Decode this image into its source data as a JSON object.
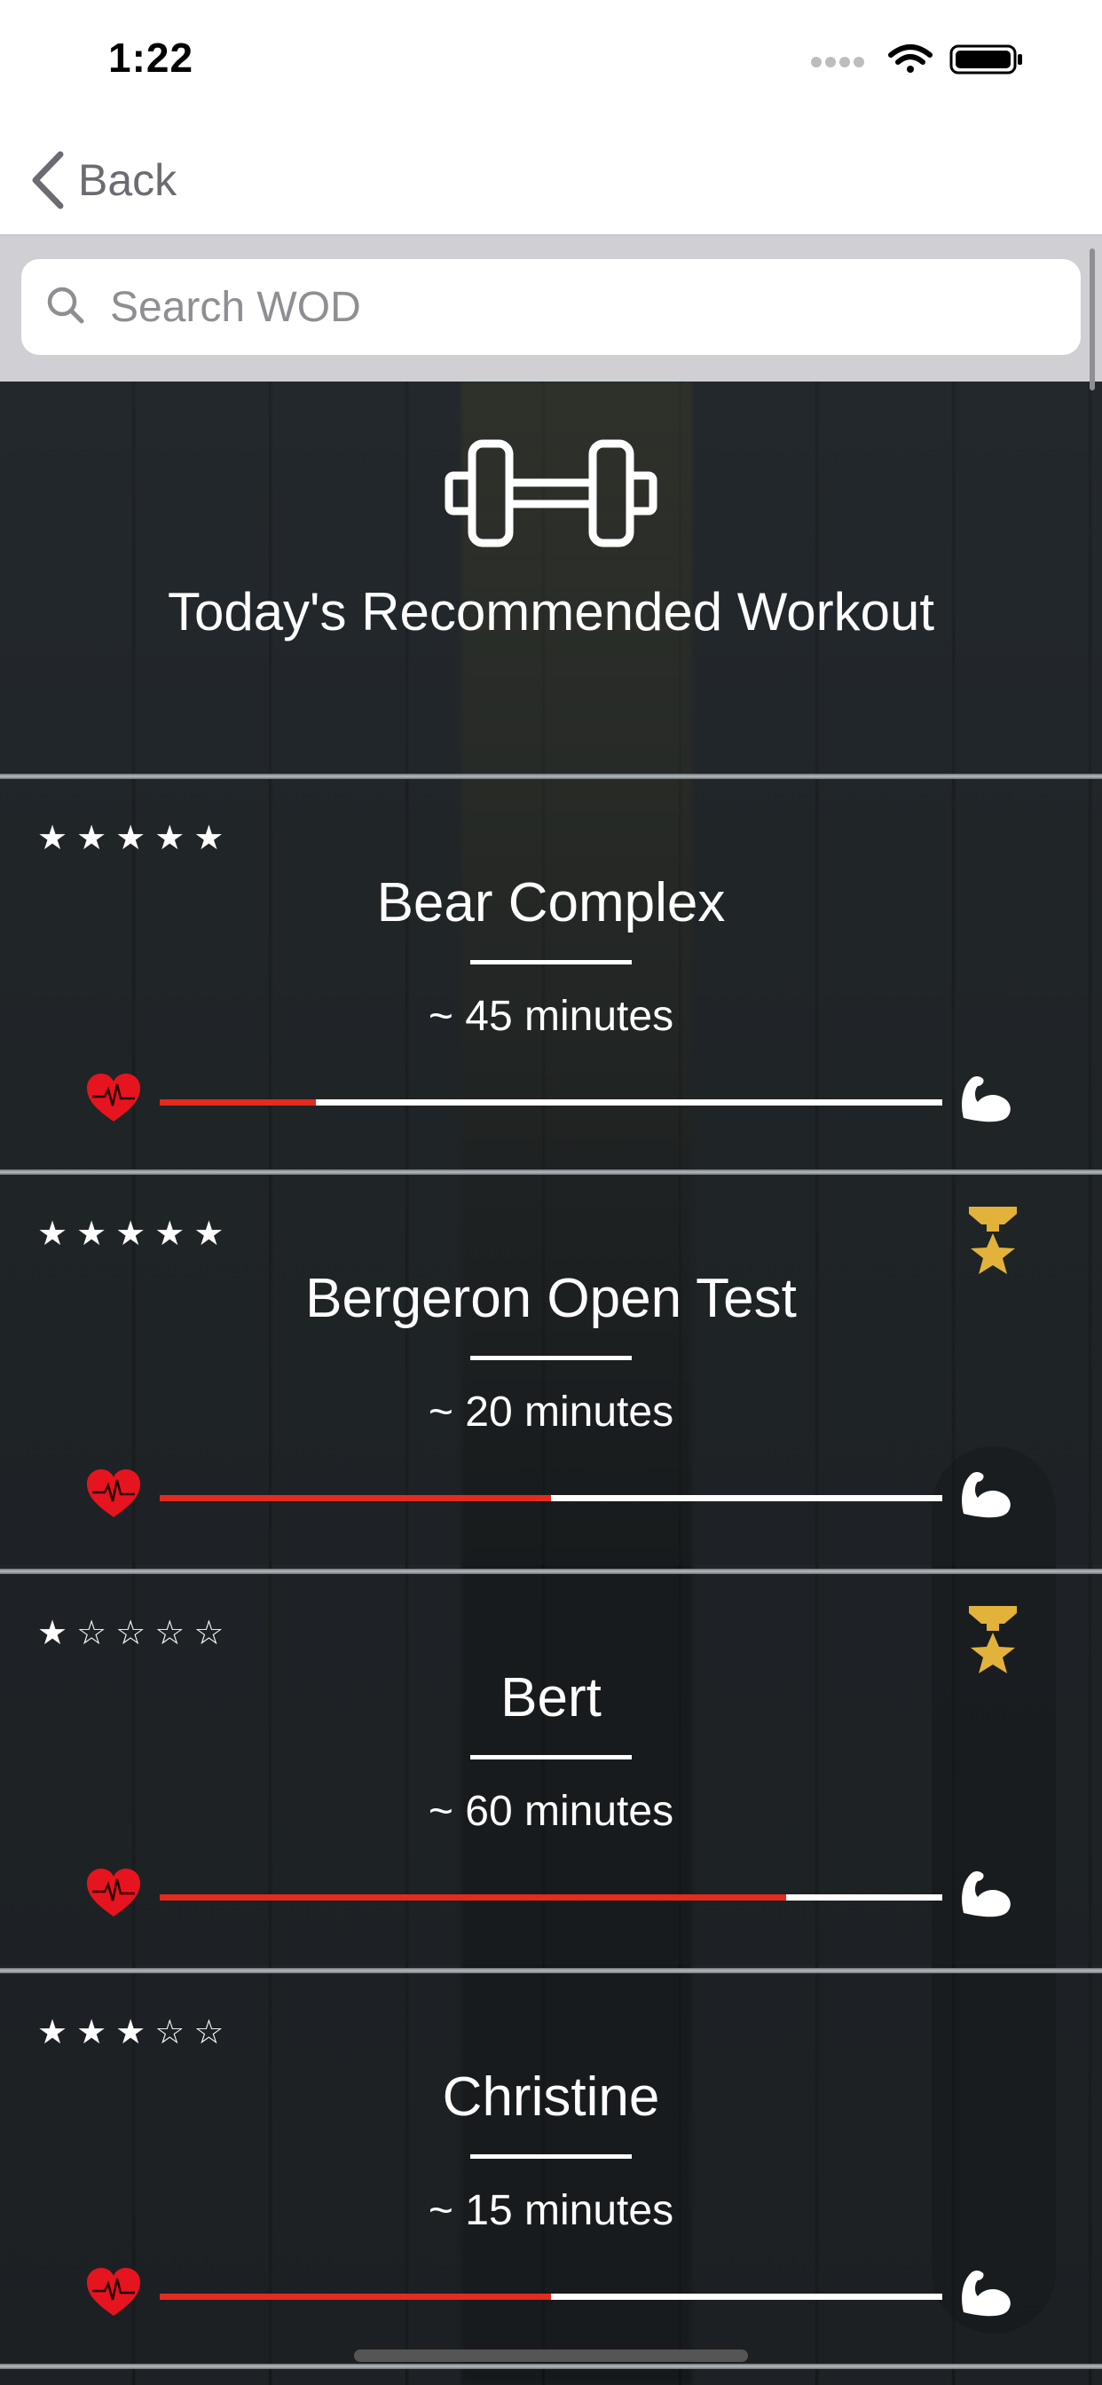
{
  "status_bar": {
    "time": "1:22"
  },
  "nav": {
    "back_label": "Back"
  },
  "search": {
    "placeholder": "Search WOD"
  },
  "hero": {
    "title": "Today's Recommended Workout",
    "icon": "dumbbell-icon"
  },
  "colors": {
    "bar_fill": "#e32b1e",
    "heart": "#e6141e",
    "medal": "#e2b23a"
  },
  "workouts": [
    {
      "name": "Bear Complex",
      "duration": "~ 45 minutes",
      "rating": 5,
      "medal": false,
      "intensity": 0.2
    },
    {
      "name": "Bergeron Open Test",
      "duration": "~ 20 minutes",
      "rating": 5,
      "medal": true,
      "intensity": 0.5
    },
    {
      "name": "Bert",
      "duration": "~ 60 minutes",
      "rating": 1,
      "medal": true,
      "intensity": 0.8
    },
    {
      "name": "Christine",
      "duration": "~ 15 minutes",
      "rating": 3,
      "medal": false,
      "intensity": 0.5
    }
  ]
}
